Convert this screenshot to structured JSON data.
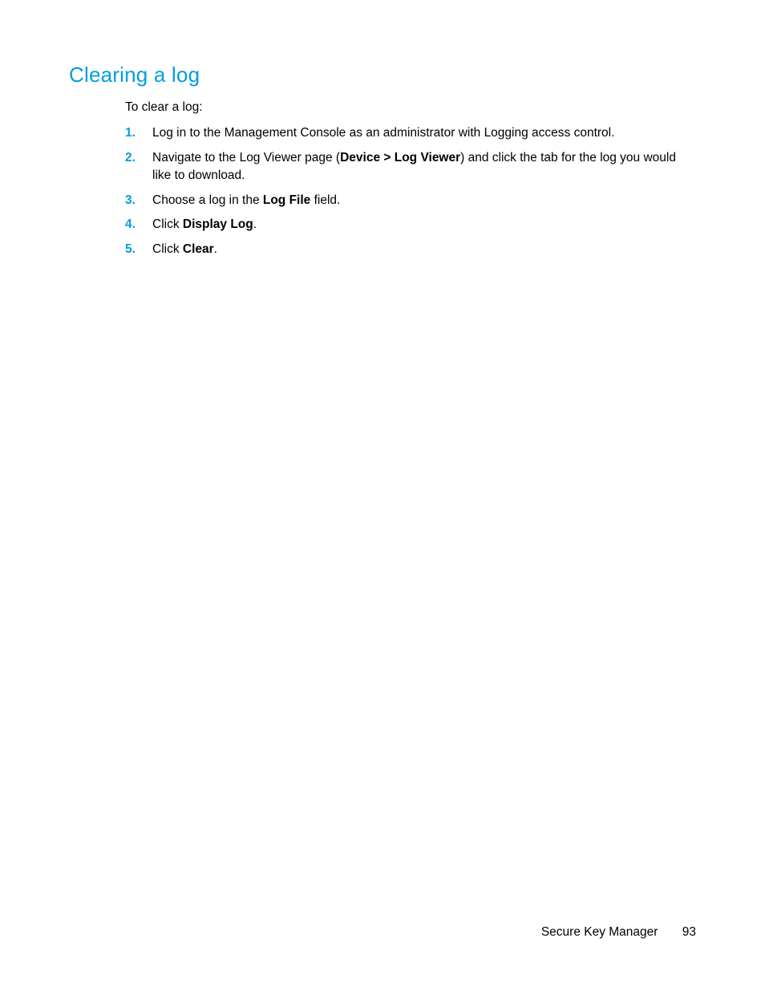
{
  "heading": "Clearing a log",
  "intro": "To clear a log:",
  "steps": [
    {
      "num": "1.",
      "runs": [
        {
          "t": "Log in to the Management Console as an administrator with Logging access control."
        }
      ]
    },
    {
      "num": "2.",
      "runs": [
        {
          "t": "Navigate to the Log Viewer page ("
        },
        {
          "t": "Device > Log Viewer",
          "b": true
        },
        {
          "t": ") and click the tab for the log you would like to download."
        }
      ]
    },
    {
      "num": "3.",
      "runs": [
        {
          "t": "Choose a log in the "
        },
        {
          "t": "Log File",
          "b": true
        },
        {
          "t": " field."
        }
      ]
    },
    {
      "num": "4.",
      "runs": [
        {
          "t": "Click "
        },
        {
          "t": "Display Log",
          "b": true
        },
        {
          "t": "."
        }
      ]
    },
    {
      "num": "5.",
      "runs": [
        {
          "t": "Click "
        },
        {
          "t": "Clear",
          "b": true
        },
        {
          "t": "."
        }
      ]
    }
  ],
  "footer": {
    "title": "Secure Key Manager",
    "page": "93"
  }
}
